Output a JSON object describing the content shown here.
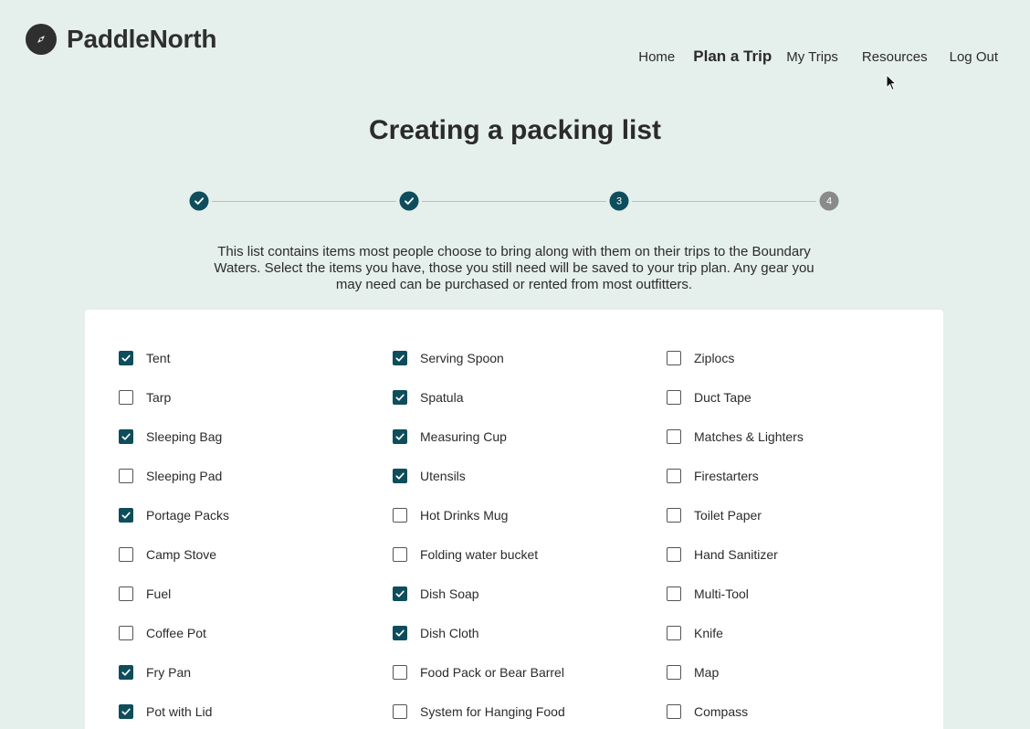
{
  "brand": {
    "name": "PaddleNorth"
  },
  "nav": {
    "home": "Home",
    "plan": "Plan a Trip",
    "trips": "My Trips",
    "resources": "Resources",
    "logout": "Log Out"
  },
  "page": {
    "title": "Creating a packing list",
    "intro": "This list contains items most people choose to bring along with them on their trips to the Boundary Waters. Select the items you have, those you still need will be saved to your trip plan. Any gear you may need can be purchased or rented from most outfitters."
  },
  "stepper": {
    "steps": [
      {
        "label": "",
        "state": "done"
      },
      {
        "label": "",
        "state": "done"
      },
      {
        "label": "3",
        "state": "current"
      },
      {
        "label": "4",
        "state": "todo"
      }
    ]
  },
  "colors": {
    "accent": "#0e4d5b",
    "background": "#e5efec",
    "todo": "#8a8a8a"
  },
  "checklist": {
    "columns": [
      [
        {
          "label": "Tent",
          "checked": true
        },
        {
          "label": "Tarp",
          "checked": false
        },
        {
          "label": "Sleeping Bag",
          "checked": true
        },
        {
          "label": "Sleeping Pad",
          "checked": false
        },
        {
          "label": "Portage Packs",
          "checked": true
        },
        {
          "label": "Camp Stove",
          "checked": false
        },
        {
          "label": "Fuel",
          "checked": false
        },
        {
          "label": "Coffee Pot",
          "checked": false
        },
        {
          "label": "Fry Pan",
          "checked": true
        },
        {
          "label": "Pot with Lid",
          "checked": true
        }
      ],
      [
        {
          "label": "Serving Spoon",
          "checked": true
        },
        {
          "label": "Spatula",
          "checked": true
        },
        {
          "label": "Measuring Cup",
          "checked": true
        },
        {
          "label": "Utensils",
          "checked": true
        },
        {
          "label": "Hot Drinks Mug",
          "checked": false
        },
        {
          "label": "Folding water bucket",
          "checked": false
        },
        {
          "label": "Dish Soap",
          "checked": true
        },
        {
          "label": "Dish Cloth",
          "checked": true
        },
        {
          "label": "Food Pack or Bear Barrel",
          "checked": false
        },
        {
          "label": "System for Hanging Food",
          "checked": false
        }
      ],
      [
        {
          "label": "Ziplocs",
          "checked": false
        },
        {
          "label": "Duct Tape",
          "checked": false
        },
        {
          "label": "Matches & Lighters",
          "checked": false
        },
        {
          "label": "Firestarters",
          "checked": false
        },
        {
          "label": "Toilet Paper",
          "checked": false
        },
        {
          "label": "Hand Sanitizer",
          "checked": false
        },
        {
          "label": "Multi-Tool",
          "checked": false
        },
        {
          "label": "Knife",
          "checked": false
        },
        {
          "label": "Map",
          "checked": false
        },
        {
          "label": "Compass",
          "checked": false
        }
      ]
    ]
  }
}
